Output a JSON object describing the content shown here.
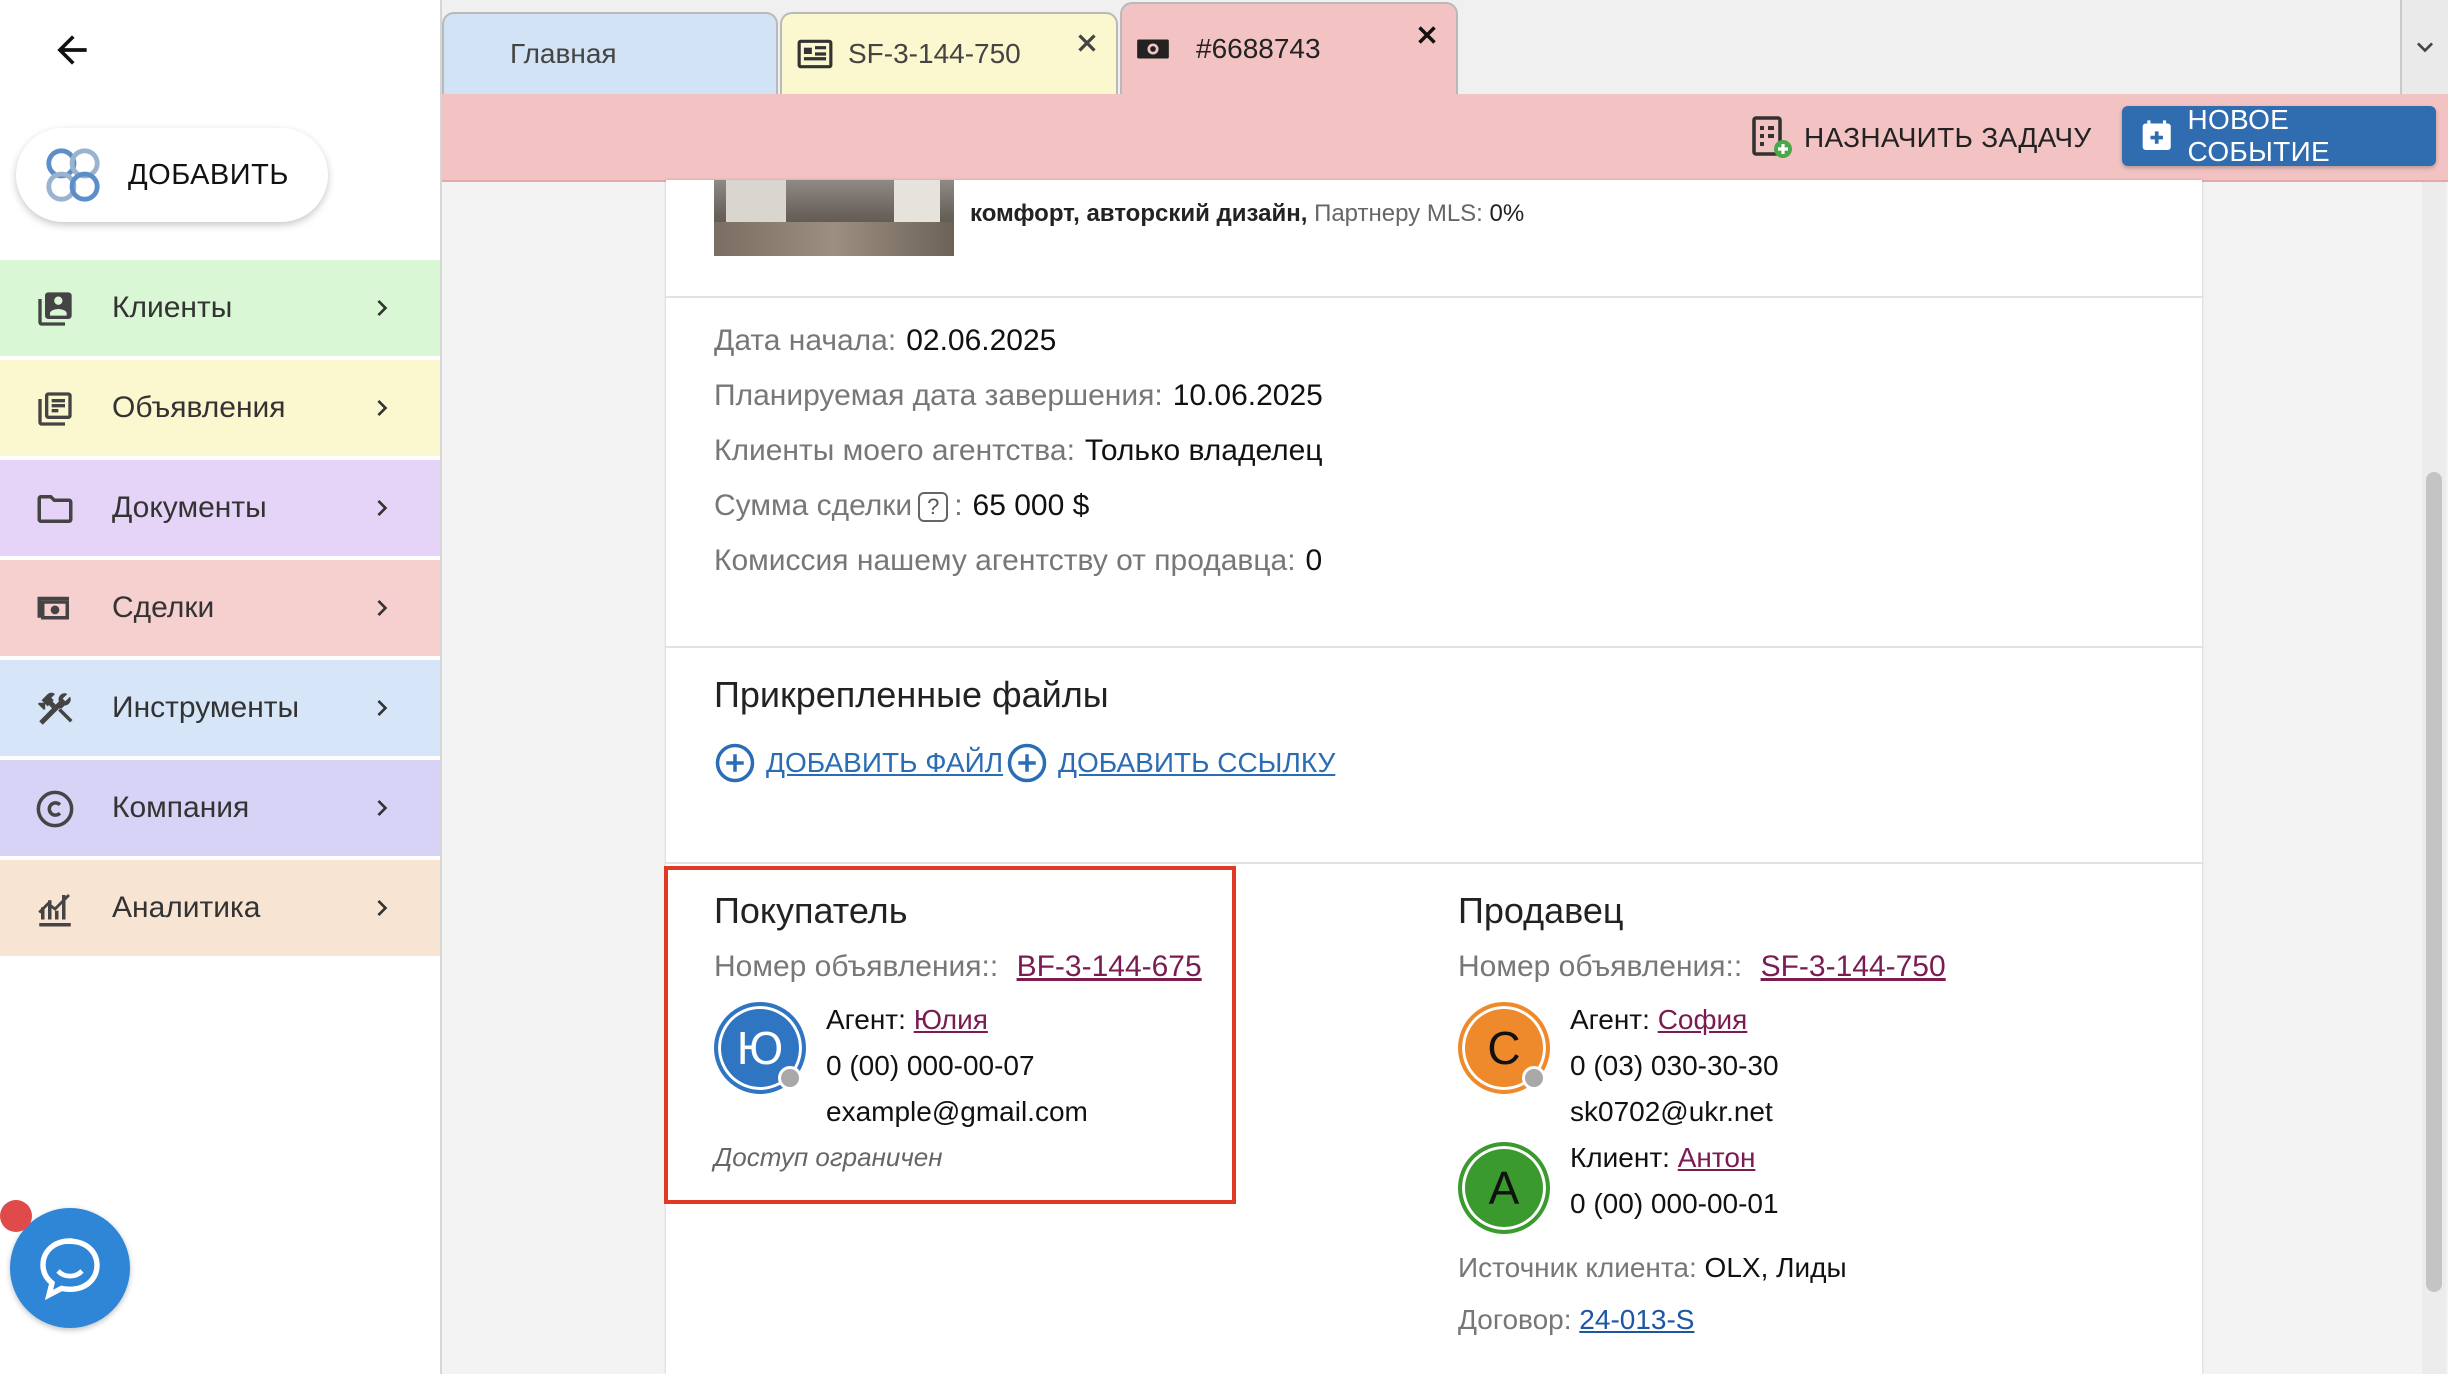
{
  "sidebar": {
    "add_label": "ДОБАВИТЬ",
    "items": [
      {
        "label": "Клиенты",
        "color": "#d9f7d4",
        "icon": "contacts-icon"
      },
      {
        "label": "Объявления",
        "color": "#fbf7cf",
        "icon": "listings-icon"
      },
      {
        "label": "Документы",
        "color": "#e5d4f7",
        "icon": "folder-icon"
      },
      {
        "label": "Сделки",
        "color": "#f6cfcf",
        "icon": "money-icon"
      },
      {
        "label": "Инструменты",
        "color": "#d6e6f8",
        "icon": "tools-icon"
      },
      {
        "label": "Компания",
        "color": "#d7d3f6",
        "icon": "copyright-icon"
      },
      {
        "label": "Аналитика",
        "color": "#f8e4d2",
        "icon": "analytics-icon"
      }
    ]
  },
  "tabs": [
    {
      "label": "Главная",
      "color": "#d3e3f6"
    },
    {
      "label": "SF-3-144-750",
      "color": "#fbf7cf"
    },
    {
      "label": "#6688743",
      "color": "#f3c3c3"
    }
  ],
  "actions": {
    "assign_task": "НАЗНАЧИТЬ ЗАДАЧУ",
    "new_event": "НОВОЕ СОБЫТИЕ"
  },
  "listing": {
    "desc_bold": "комфорт, авторский дизайн,",
    "partner_label": "Партнеру MLS:",
    "partner_value": "0%"
  },
  "details": {
    "start_label": "Дата начала:",
    "start_value": "02.06.2025",
    "end_label": "Планируемая дата завершения:",
    "end_value": "10.06.2025",
    "clients_label": "Клиенты моего агентства:",
    "clients_value": "Только владелец",
    "sum_label": "Сумма сделки",
    "sum_help": "?",
    "sum_colon": ":",
    "sum_value": "65 000 $",
    "commission_label": "Комиссия нашему агентству от продавца:",
    "commission_value": "0"
  },
  "files": {
    "title": "Прикрепленные файлы",
    "add_file": "ДОБАВИТЬ ФАЙЛ",
    "add_link": "ДОБАВИТЬ ССЫЛКУ"
  },
  "buyer": {
    "title": "Покупатель",
    "listing_label": "Номер объявления::",
    "listing_value": "BF-3-144-675",
    "avatar_letter": "Ю",
    "avatar_color": "#2f75c2",
    "agent_label": "Агент:",
    "agent_name": "Юлия",
    "phone": "0 (00) 000-00-07",
    "email": "example@gmail.com",
    "access": "Доступ ограничен"
  },
  "seller": {
    "title": "Продавец",
    "listing_label": "Номер объявления::",
    "listing_value": "SF-3-144-750",
    "agent_avatar_letter": "С",
    "agent_avatar_color": "#ee8a2c",
    "agent_label": "Агент:",
    "agent_name": "София",
    "agent_phone": "0 (03) 030-30-30",
    "agent_email": "sk0702@ukr.net",
    "client_avatar_letter": "А",
    "client_avatar_color": "#3a9a2e",
    "client_label": "Клиент:",
    "client_name": "Антон",
    "client_phone": "0 (00) 000-00-01",
    "source_label": "Источник клиента:",
    "source_value": "OLX, Лиды",
    "contract_label": "Договор:",
    "contract_value": "24-013-S"
  }
}
